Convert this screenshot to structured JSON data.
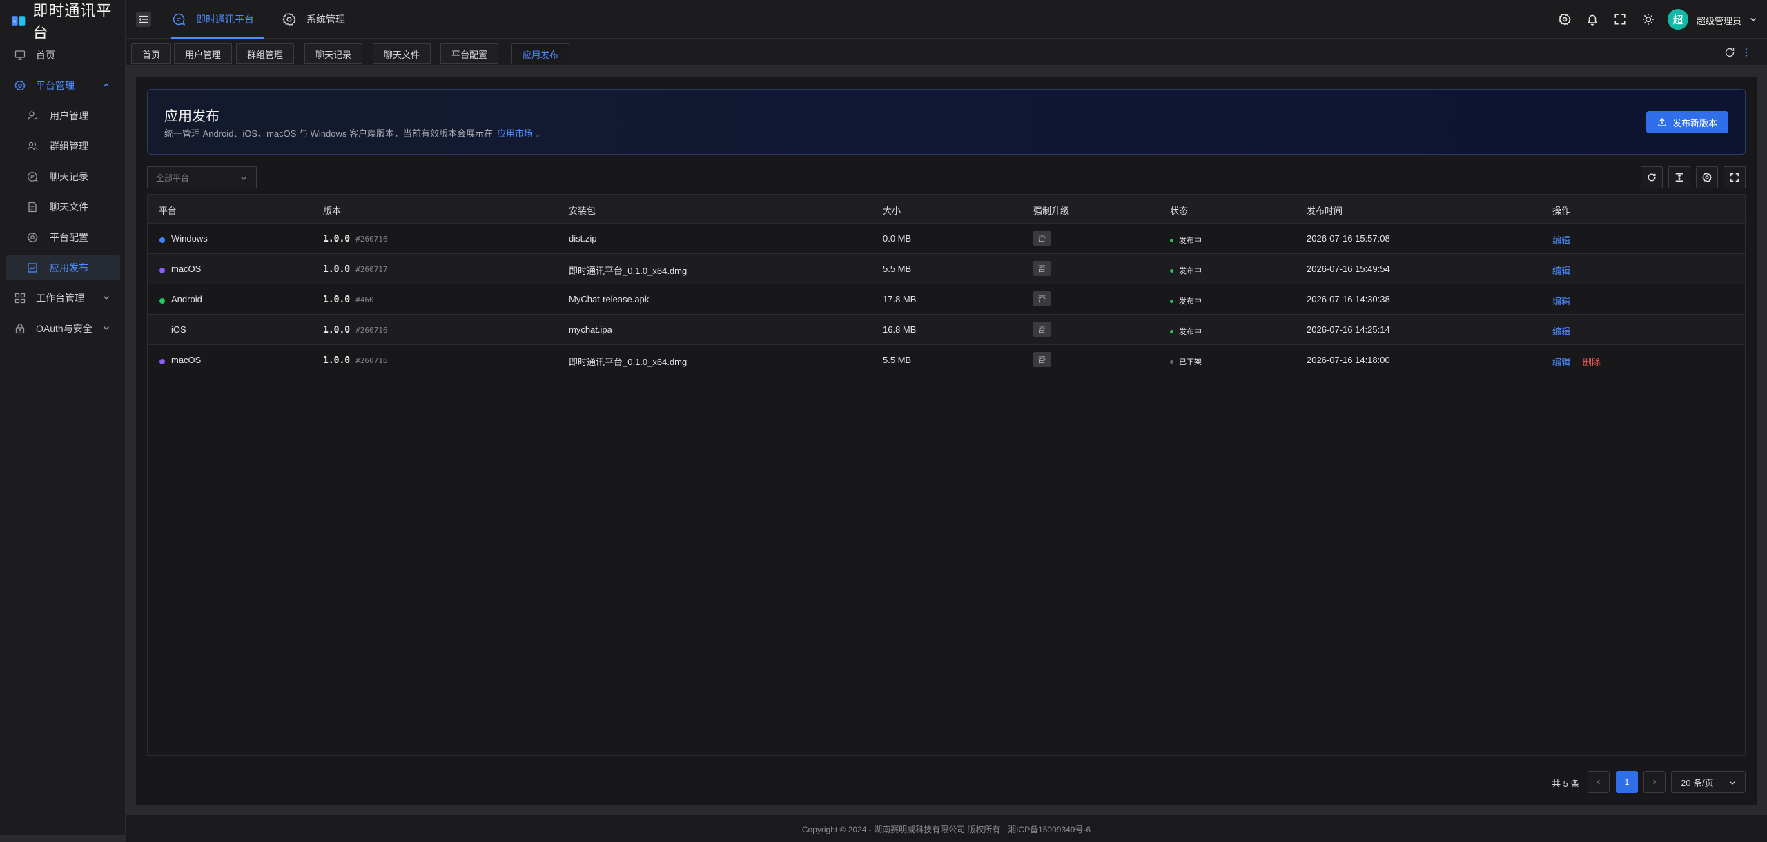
{
  "app": {
    "title": "即时通讯平台",
    "brand_color": "#2f6fea",
    "accent_color": "#4c8dff"
  },
  "sidebar": {
    "items": [
      {
        "label": "首页",
        "icon": "monitor-icon"
      },
      {
        "label": "平台管理",
        "icon": "settings-icon",
        "expanded": true
      },
      {
        "label": "用户管理",
        "icon": "user-icon"
      },
      {
        "label": "群组管理",
        "icon": "users-icon"
      },
      {
        "label": "聊天记录",
        "icon": "chat-icon"
      },
      {
        "label": "聊天文件",
        "icon": "file-icon"
      },
      {
        "label": "平台配置",
        "icon": "gear-icon"
      },
      {
        "label": "应用发布",
        "icon": "publish-icon",
        "active": true
      },
      {
        "label": "工作台管理",
        "icon": "grid-icon"
      },
      {
        "label": "OAuth与安全",
        "icon": "shield-icon"
      }
    ]
  },
  "header": {
    "tabs": [
      {
        "label": "即时通讯平台",
        "icon": "chat-icon",
        "active": true
      },
      {
        "label": "系统管理",
        "icon": "gear-icon"
      }
    ],
    "icons": [
      "settings-icon",
      "bell-icon",
      "fullscreen-icon",
      "theme-icon"
    ],
    "user": {
      "avatar": "超",
      "name": "超级管理员",
      "avatar_color": "#14b8a6"
    }
  },
  "page_tabs": [
    "首页",
    "用户管理",
    "群组管理",
    "聊天记录",
    "聊天文件",
    "平台配置",
    "应用发布"
  ],
  "banner": {
    "title": "应用发布",
    "desc": "统一管理 Android、iOS、macOS 与 Windows 客户端版本，当前有效版本会展示在",
    "link": "应用市场",
    "period": "。",
    "publish_button": "发布新版本"
  },
  "filter": {
    "platform_placeholder": "全部平台"
  },
  "table": {
    "columns": [
      "平台",
      "版本",
      "安装包",
      "大小",
      "强制升级",
      "状态",
      "发布时间",
      "操作"
    ],
    "rows": [
      {
        "platform": "Windows",
        "dot_color": "#3b82f6",
        "version": "1.0.0",
        "build": "#260716",
        "package": "dist.zip",
        "size": "0.0 MB",
        "force": "否",
        "status": "发布中",
        "status_color": "#22c55e",
        "time": "2026-07-16 15:57:08",
        "actions": [
          "编辑"
        ]
      },
      {
        "platform": "macOS",
        "dot_color": "#8b5cf6",
        "version": "1.0.0",
        "build": "#260717",
        "package": "即时通讯平台_0.1.0_x64.dmg",
        "size": "5.5 MB",
        "force": "否",
        "status": "发布中",
        "status_color": "#22c55e",
        "time": "2026-07-16 15:49:54",
        "actions": [
          "编辑"
        ]
      },
      {
        "platform": "Android",
        "dot_color": "#22c55e",
        "version": "1.0.0",
        "build": "#460",
        "package": "MyChat-release.apk",
        "size": "17.8 MB",
        "force": "否",
        "status": "发布中",
        "status_color": "#22c55e",
        "time": "2026-07-16 14:30:38",
        "actions": [
          "编辑"
        ]
      },
      {
        "platform": "iOS",
        "dot_color": "",
        "version": "1.0.0",
        "build": "#260716",
        "package": "mychat.ipa",
        "size": "16.8 MB",
        "force": "否",
        "status": "发布中",
        "status_color": "#22c55e",
        "time": "2026-07-16 14:25:14",
        "actions": [
          "编辑"
        ]
      },
      {
        "platform": "macOS",
        "dot_color": "#8b5cf6",
        "version": "1.0.0",
        "build": "#260716",
        "package": "即时通讯平台_0.1.0_x64.dmg",
        "size": "5.5 MB",
        "force": "否",
        "status": "已下架",
        "status_color": "#6b6d73",
        "time": "2026-07-16 14:18:00",
        "actions": [
          "编辑",
          "删除"
        ]
      }
    ]
  },
  "pagination": {
    "total": "共 5 条",
    "current": "1",
    "page_size": "20 条/页"
  },
  "footer": {
    "text": "Copyright © 2024 - 湖南赛明威科技有限公司 版权所有 · 湘ICP备15009349号-6"
  }
}
